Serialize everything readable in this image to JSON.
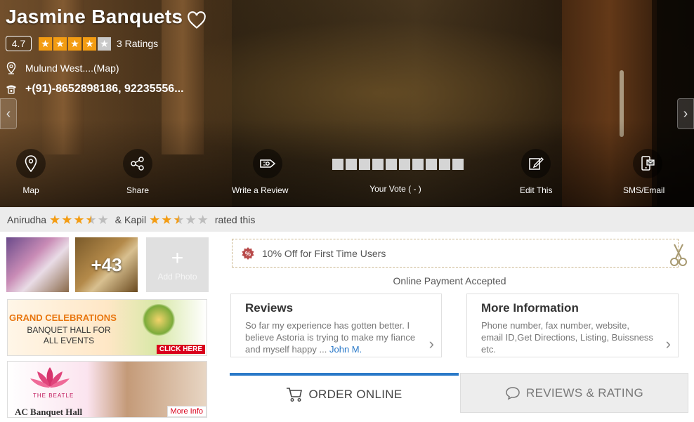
{
  "hero": {
    "title": "Jasmine Banquets",
    "rating_value": "4.7",
    "stars": [
      true,
      true,
      true,
      true,
      false
    ],
    "ratings_count": "3 Ratings",
    "address": "Mulund West....(Map)",
    "phone": "+(91)-8652898186, 92235556..."
  },
  "actions": {
    "map": "Map",
    "share": "Share",
    "write_review": "Write a Review",
    "your_vote": "Your Vote ( - )",
    "edit_this": "Edit This",
    "sms_email": "SMS/Email"
  },
  "raters": {
    "user1": "Anirudha",
    "user1_rating": 3.5,
    "joiner": "& Kapil",
    "user2_rating": 2.5,
    "suffix": "rated this"
  },
  "photos": {
    "more_count": "+43",
    "add_photo_label": "Add Photo"
  },
  "ads": {
    "banner1_title": "GRAND CELEBRATIONS",
    "banner1_sub": "BANQUET HALL FOR ALL EVENTS",
    "banner1_cta": "CLICK HERE",
    "banner2_brand": "THE BEATLE",
    "banner2_title": "AC Banquet Hall",
    "banner2_cta": "More Info"
  },
  "offer": {
    "text": "10% Off for First Time Users"
  },
  "payment_note": "Online Payment Accepted",
  "reviews_card": {
    "title": "Reviews",
    "snippet": "So far my experience has gotten better. I believe Astoria is trying to make my fiance and myself happy",
    "ellipsis": "...",
    "author": "John M."
  },
  "info_card": {
    "title": "More Information",
    "text": "Phone number, fax number, website, email ID,Get Directions, Listing, Buissness etc."
  },
  "tabs": {
    "order_online": "ORDER ONLINE",
    "reviews_rating": "REVIEWS & RATING"
  },
  "colors": {
    "accent_blue": "#2a79c8",
    "star_orange": "#f39c12",
    "cta_red": "#d9001b"
  }
}
